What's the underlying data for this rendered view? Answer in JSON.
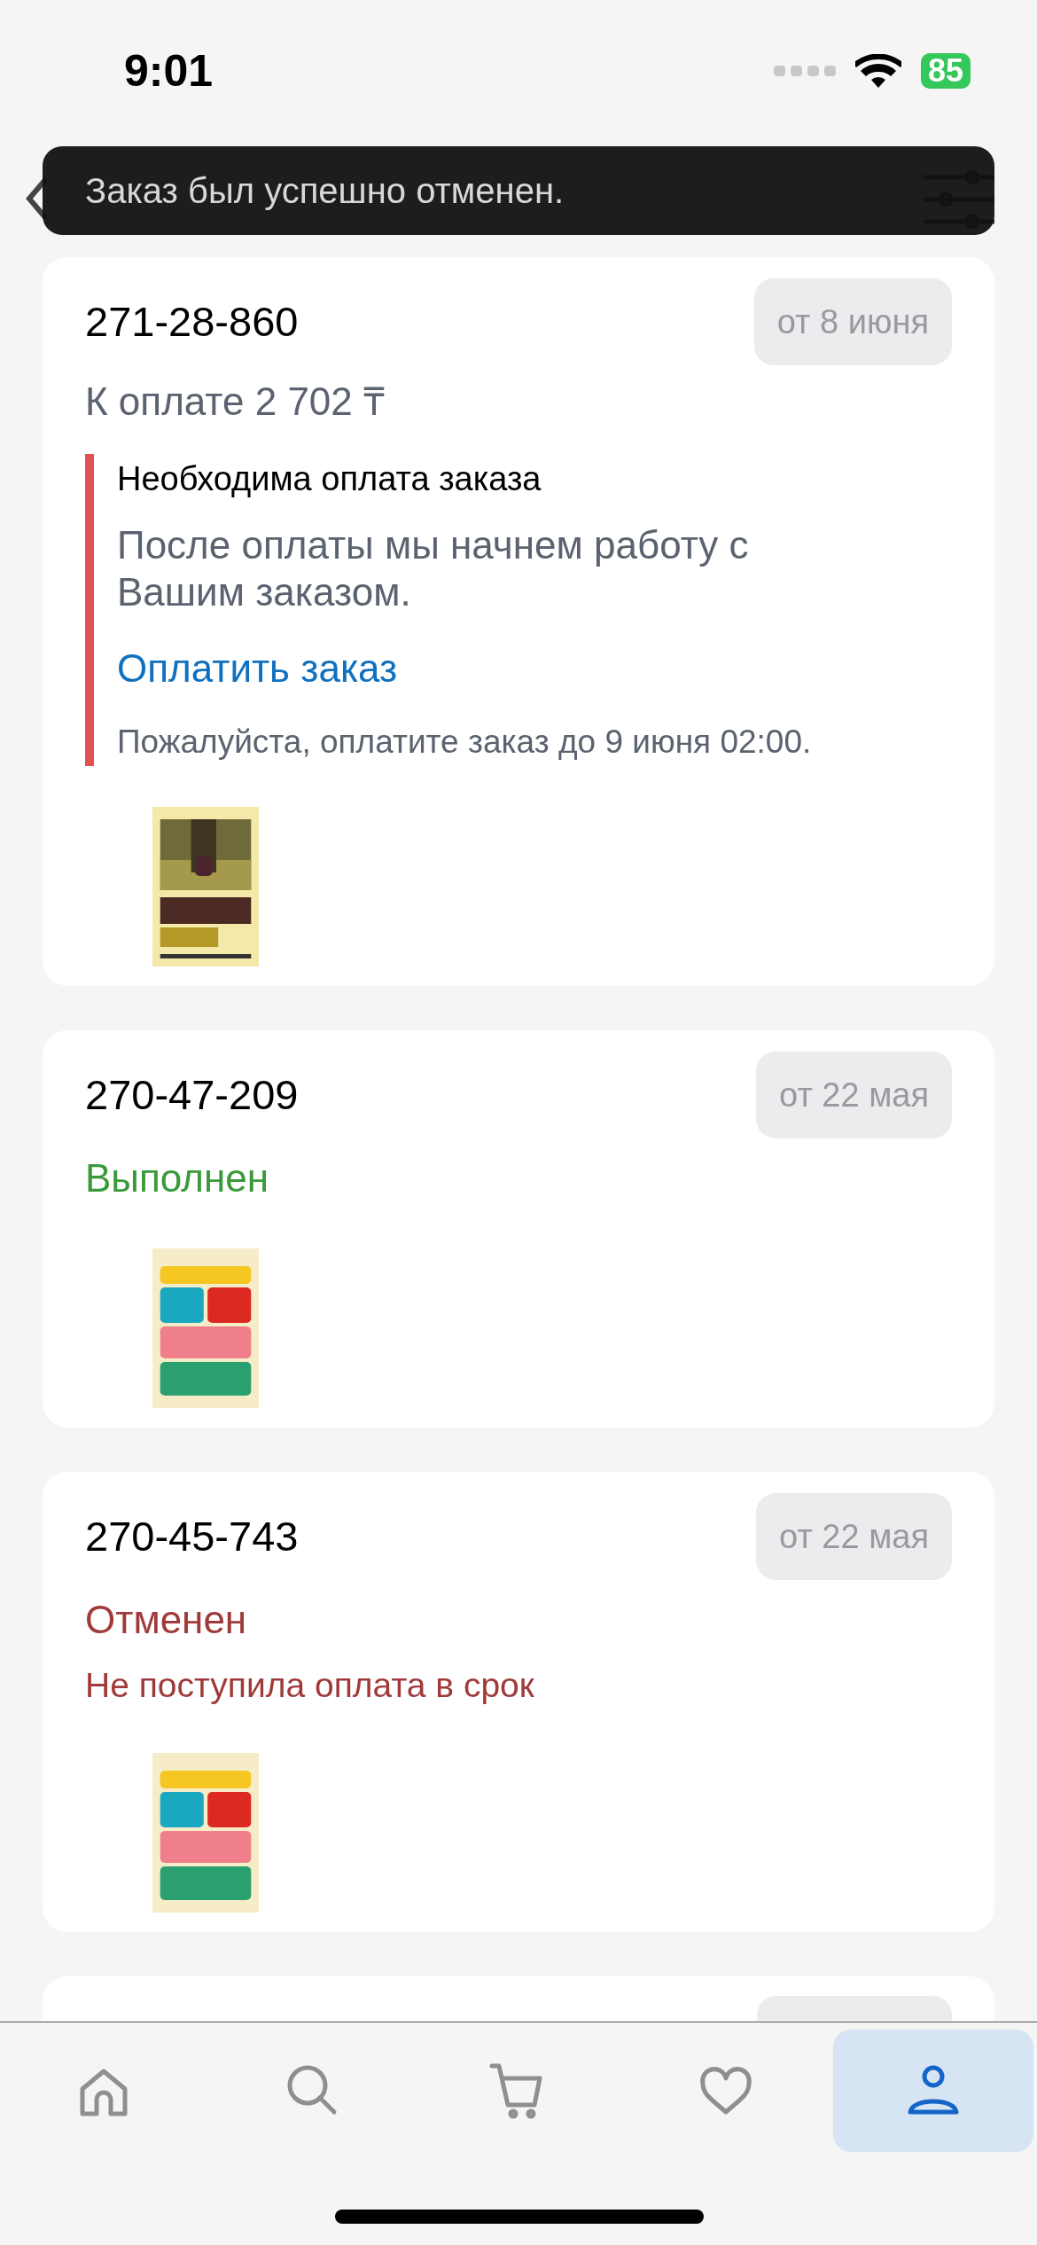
{
  "status_bar": {
    "time": "9:01",
    "battery": "85"
  },
  "toast": {
    "message": "Заказ был успешно отменен."
  },
  "orders": [
    {
      "number": "271-28-860",
      "date": "от 8 июня",
      "kind": "payment_due",
      "amount": "К оплате 2 702 ₸",
      "notice": {
        "title": "Необходима оплата заказа",
        "body": "После оплаты мы начнем работу с Вашим заказом.",
        "link": "Оплатить заказ",
        "deadline": "Пожалуйста, оплатите заказ до 9 июня 02:00."
      }
    },
    {
      "number": "270-47-209",
      "date": "от 22 мая",
      "kind": "completed",
      "status": "Выполнен"
    },
    {
      "number": "270-45-743",
      "date": "от 22 мая",
      "kind": "cancelled",
      "status": "Отменен",
      "reason": "Не поступила оплата в срок"
    }
  ],
  "tab_bar": {
    "tabs": [
      {
        "kind": "home",
        "selected": false
      },
      {
        "kind": "search",
        "selected": false
      },
      {
        "kind": "cart",
        "selected": false
      },
      {
        "kind": "favorites",
        "selected": false
      },
      {
        "kind": "profile",
        "selected": true
      }
    ]
  }
}
